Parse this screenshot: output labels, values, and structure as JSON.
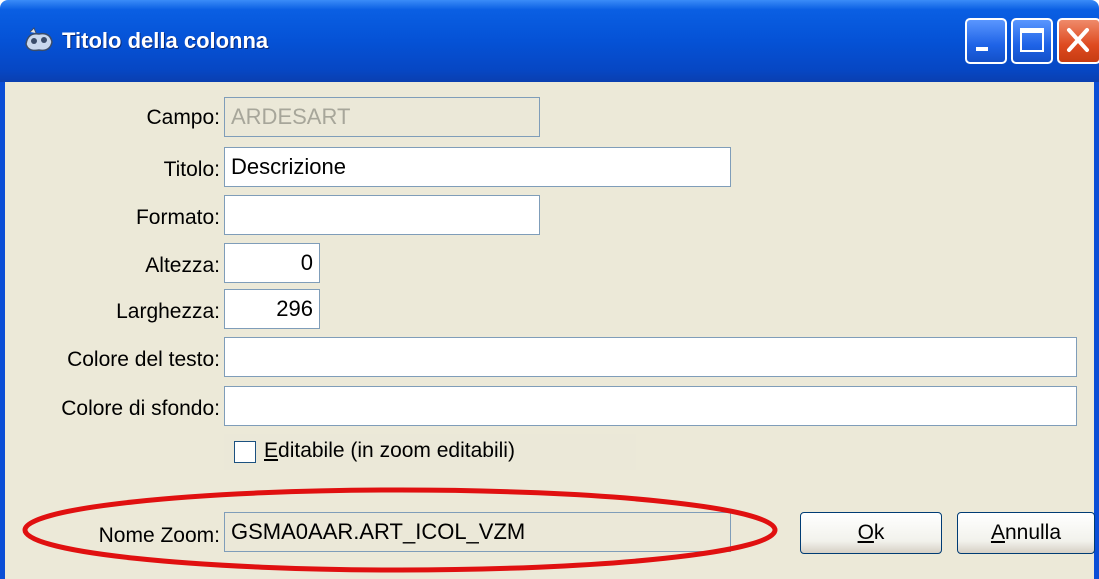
{
  "window": {
    "title": "Titolo della colonna"
  },
  "form": {
    "campo": {
      "label": "Campo:",
      "value": "ARDESART"
    },
    "titolo": {
      "label": "Titolo:",
      "value": "Descrizione"
    },
    "formato": {
      "label": "Formato:",
      "value": ""
    },
    "altezza": {
      "label": "Altezza:",
      "value": "0"
    },
    "larghezza": {
      "label": "Larghezza:",
      "value": "296"
    },
    "colore_testo": {
      "label": "Colore del testo:",
      "value": ""
    },
    "colore_sfondo": {
      "label": "Colore di sfondo:",
      "value": ""
    },
    "editabile": {
      "mnemonic": "E",
      "rest": "ditabile (in zoom editabili)",
      "checked": false
    },
    "nome_zoom": {
      "label": "Nome Zoom:",
      "value": "GSMA0AAR.ART_ICOL_VZM"
    }
  },
  "buttons": {
    "ok": {
      "mnemonic": "O",
      "rest": "k"
    },
    "annulla": {
      "mnemonic": "A",
      "rest": "nnulla"
    }
  },
  "colors": {
    "titlebar": "#0552d6",
    "client": "#ece9d8",
    "highlight_ellipse": "#e01010"
  },
  "icons": [
    "app-icon",
    "minimize-icon",
    "maximize-icon",
    "close-icon",
    "checkbox"
  ]
}
